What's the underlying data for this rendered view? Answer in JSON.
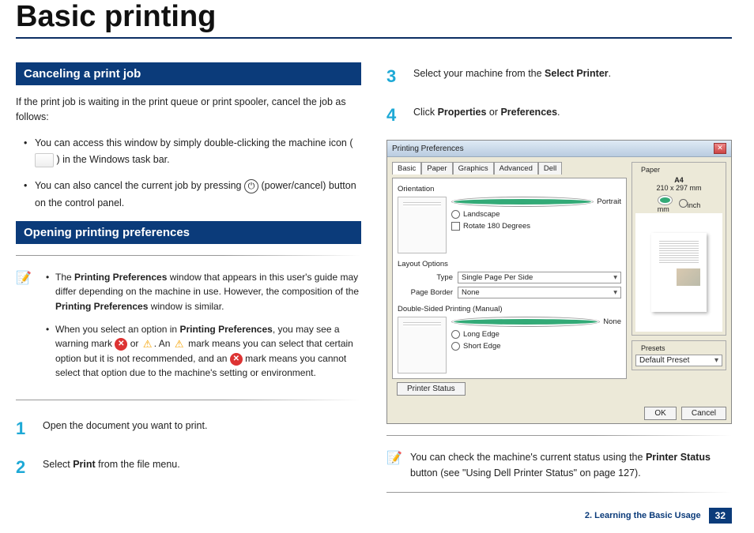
{
  "title": "Basic printing",
  "left": {
    "sec1": {
      "heading": "Canceling a print job",
      "intro": "If the print job is waiting in the print queue or print spooler, cancel the job as follows:",
      "b1a": "You can access this window by simply double-clicking the machine icon",
      "b1b": ") in the Windows task bar.",
      "b2a": "You can also cancel the current job by pressing ",
      "b2b": "(power/cancel) button on the control panel."
    },
    "sec2": {
      "heading": "Opening printing preferences",
      "note1a": "The ",
      "note1b": "Printing Preferences",
      "note1c": " window that appears in this user's guide may differ depending on the machine in use. However, the composition of the ",
      "note1d": "Printing Preferences",
      "note1e": " window is similar.",
      "note2a": "When you select an option in ",
      "note2b": "Printing Preferences",
      "note2c": ", you may see a warning mark ",
      "note2d": " or ",
      "note2e": ". An ",
      "note2f": " mark means you can select that certain option but it is not recommended, and an ",
      "note2g": " mark means you cannot select that option due to the machine's setting or environment."
    },
    "steps": {
      "s1n": "1",
      "s1": "Open the document you want to print.",
      "s2n": "2",
      "s2a": "Select ",
      "s2b": "Print",
      "s2c": " from the file menu."
    }
  },
  "right": {
    "steps": {
      "s3n": "3",
      "s3a": "Select your machine from the ",
      "s3b": "Select Printer",
      "s3c": ".",
      "s4n": "4",
      "s4a": "Click ",
      "s4b": "Properties",
      "s4c": " or ",
      "s4d": "Preferences",
      "s4e": "."
    },
    "dialog": {
      "title": "Printing Preferences",
      "tabs": [
        "Basic",
        "Paper",
        "Graphics",
        "Advanced",
        "Dell"
      ],
      "orientation": {
        "label": "Orientation",
        "portrait": "Portrait",
        "landscape": "Landscape",
        "rotate": "Rotate 180 Degrees"
      },
      "layout": {
        "label": "Layout Options",
        "type": "Type",
        "typev": "Single Page Per Side",
        "border": "Page Border",
        "borderv": "None"
      },
      "duplex": {
        "label": "Double-Sided Printing (Manual)",
        "none": "None",
        "long": "Long Edge",
        "short": "Short Edge"
      },
      "paper": {
        "label": "Paper",
        "size": "A4",
        "dims": "210 x 297 mm",
        "mm": "mm",
        "inch": "inch"
      },
      "presets": {
        "label": "Presets",
        "value": "Default Preset"
      },
      "printer_status": "Printer Status",
      "ok": "OK",
      "cancel": "Cancel"
    },
    "note": {
      "a": "You can check the machine's current status using the ",
      "b": "Printer Status",
      "c": " button (see \"Using Dell Printer Status\" on page 127)."
    }
  },
  "footer": {
    "chapter": "2. Learning the Basic Usage",
    "page": "32"
  }
}
